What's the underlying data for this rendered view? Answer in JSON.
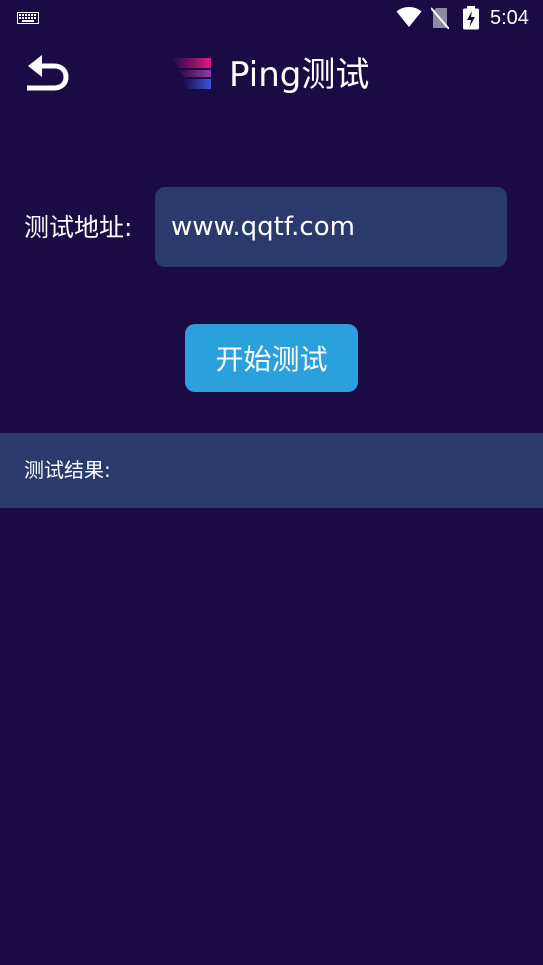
{
  "status_bar": {
    "time": "5:04",
    "icons": [
      "keyboard-icon",
      "wifi-icon",
      "no-sim-icon",
      "battery-charging-icon"
    ]
  },
  "header": {
    "title": "Ping测试",
    "back_icon": "back-arrow-icon",
    "logo_icon": "logo-icon"
  },
  "form": {
    "address_label": "测试地址:",
    "address_value": "www.qqtf.com",
    "start_button_label": "开始测试"
  },
  "results": {
    "label": "测试结果:"
  },
  "colors": {
    "background": "#1a0b45",
    "field_background": "#2b3a6c",
    "button_background": "#2aa1dd",
    "logo_pink": "#e0187e",
    "logo_blue": "#3a56d8"
  }
}
